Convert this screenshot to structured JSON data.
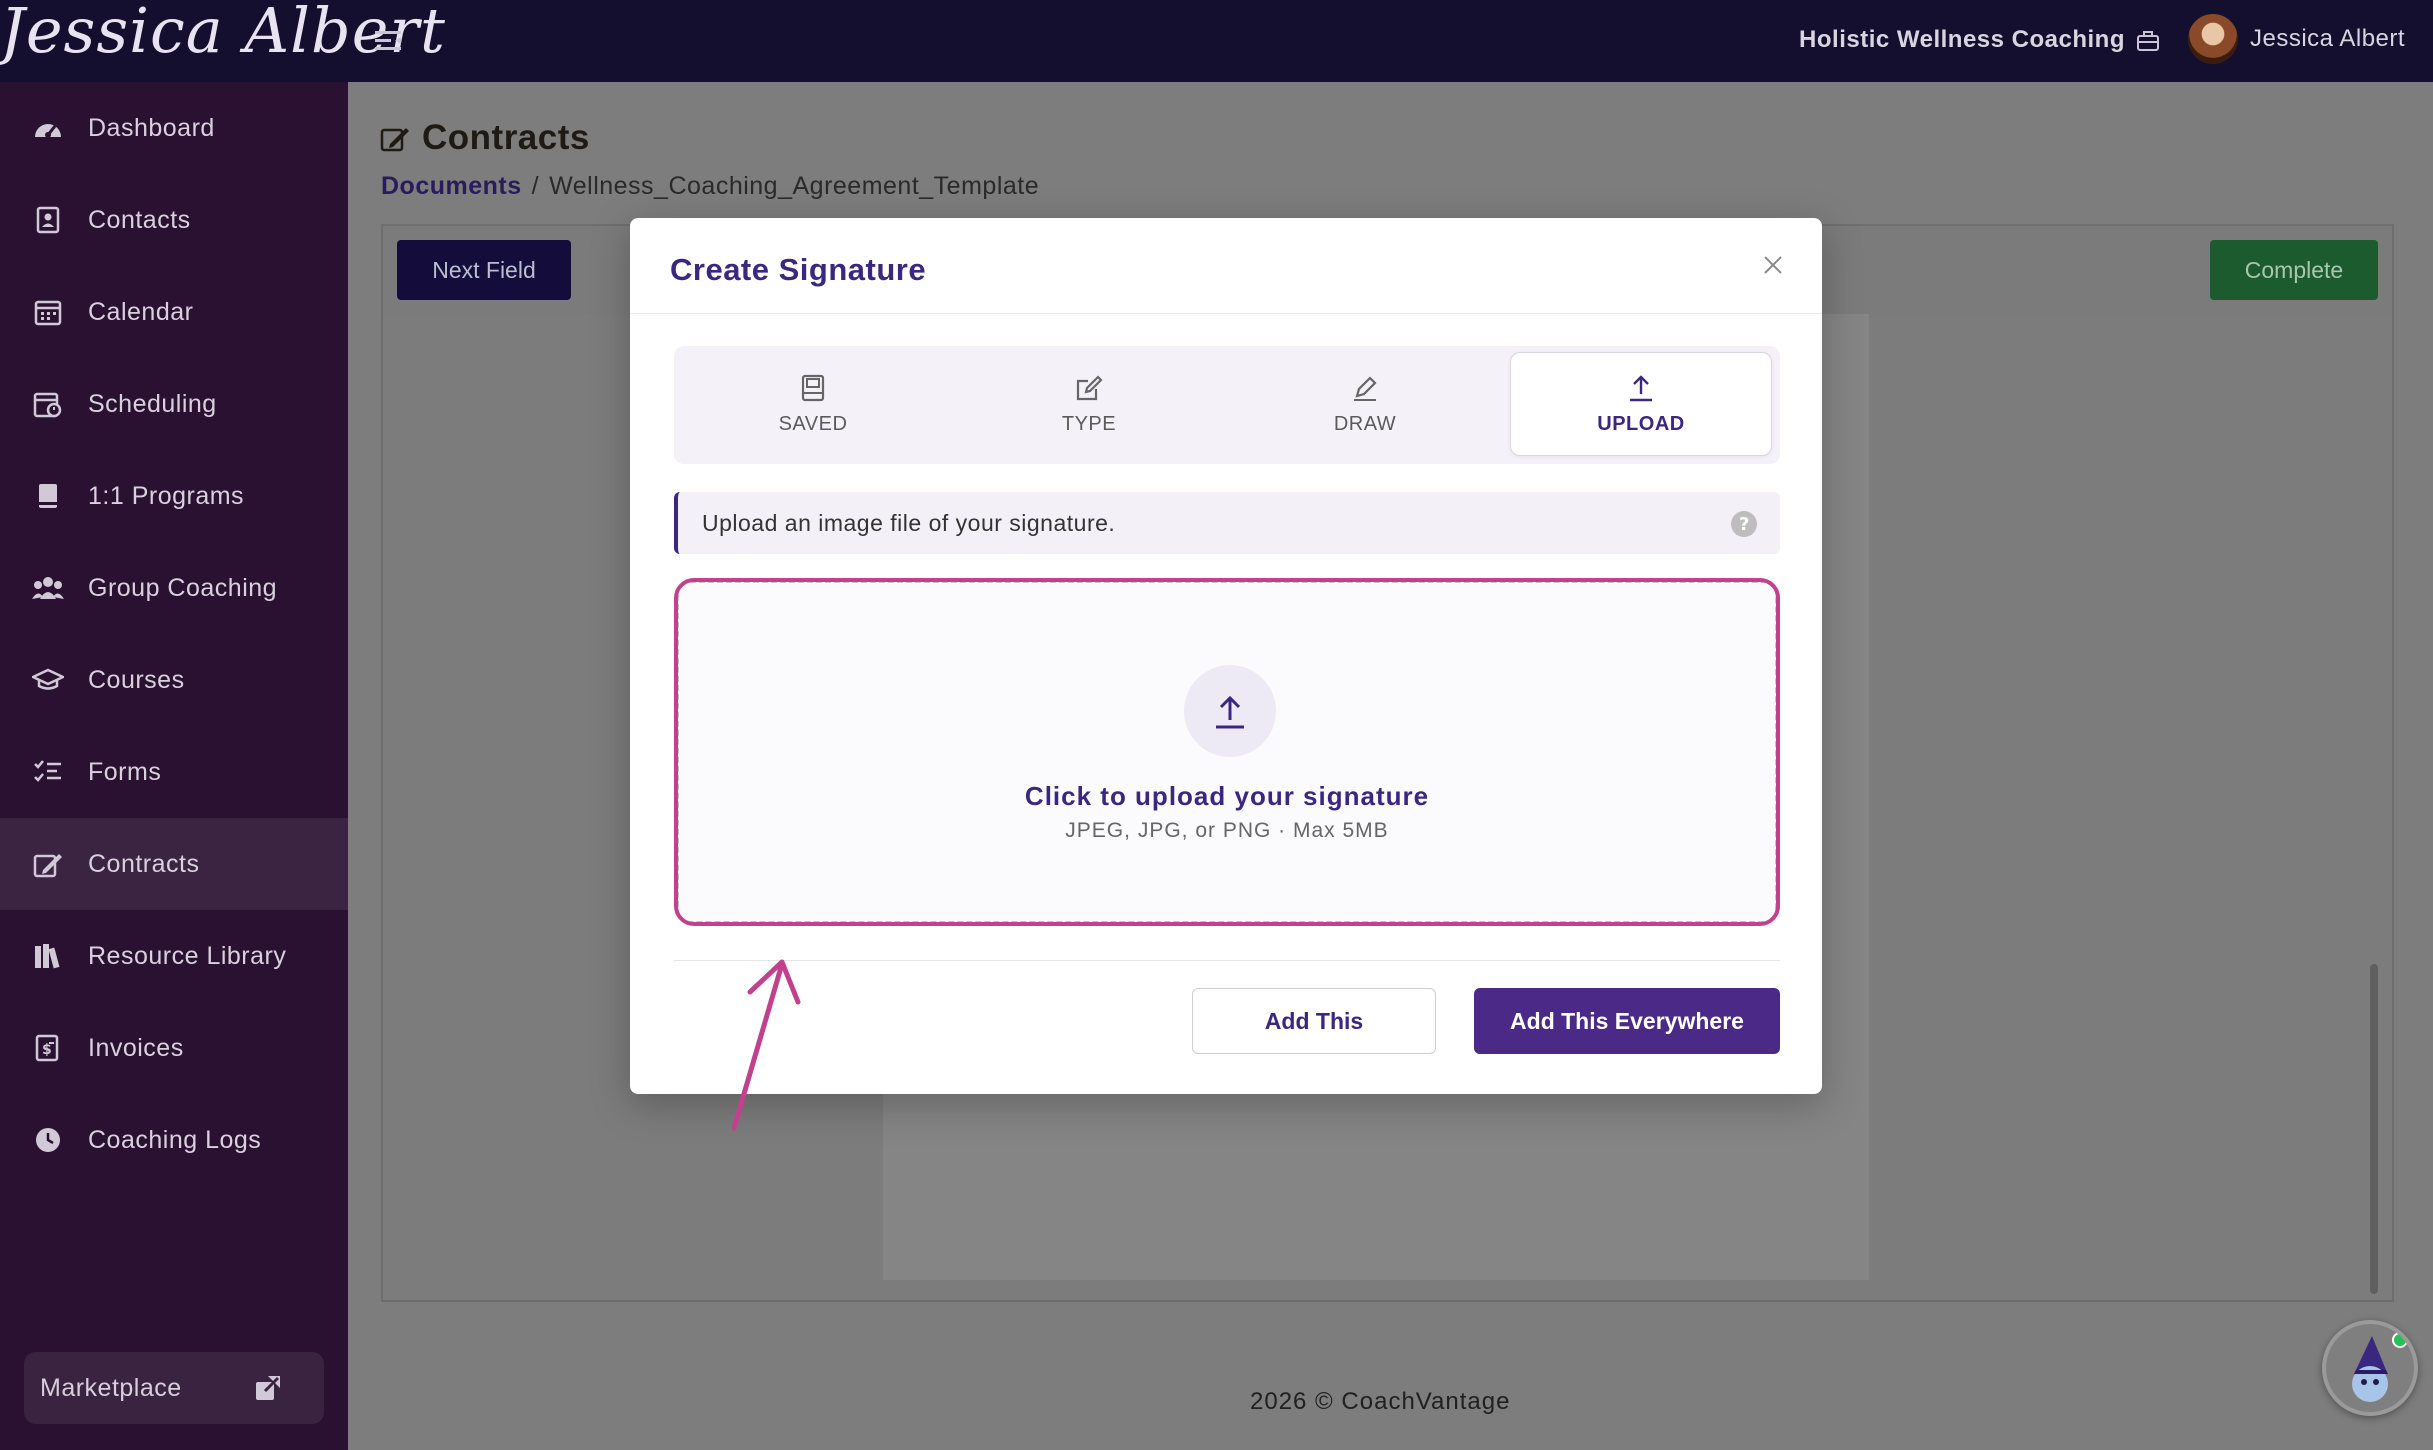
{
  "header": {
    "brand": "Jessica Albert",
    "organization": "Holistic Wellness Coaching",
    "user_name": "Jessica Albert"
  },
  "sidebar": {
    "items": [
      {
        "label": "Dashboard",
        "icon": "dashboard-icon"
      },
      {
        "label": "Contacts",
        "icon": "contacts-icon"
      },
      {
        "label": "Calendar",
        "icon": "calendar-icon"
      },
      {
        "label": "Scheduling",
        "icon": "scheduling-icon"
      },
      {
        "label": "1:1 Programs",
        "icon": "book-icon"
      },
      {
        "label": "Group Coaching",
        "icon": "group-icon"
      },
      {
        "label": "Courses",
        "icon": "graduation-cap-icon"
      },
      {
        "label": "Forms",
        "icon": "list-check-icon"
      },
      {
        "label": "Contracts",
        "icon": "signature-icon",
        "active": true
      },
      {
        "label": "Resource Library",
        "icon": "library-icon"
      },
      {
        "label": "Invoices",
        "icon": "invoice-icon"
      },
      {
        "label": "Coaching Logs",
        "icon": "clock-icon"
      }
    ],
    "marketplace": "Marketplace"
  },
  "main": {
    "title": "Contracts",
    "breadcrumb": {
      "parent": "Documents",
      "separator": "/",
      "current": "Wellness_Coaching_Agreement_Template"
    },
    "toolbar": {
      "next_field": "Next Field",
      "complete": "Complete"
    },
    "footer": "2026 © CoachVantage"
  },
  "modal": {
    "title": "Create Signature",
    "tabs": [
      {
        "label": "SAVED",
        "icon": "saved-icon"
      },
      {
        "label": "TYPE",
        "icon": "edit-icon"
      },
      {
        "label": "DRAW",
        "icon": "pen-icon"
      },
      {
        "label": "UPLOAD",
        "icon": "upload-icon",
        "active": true
      }
    ],
    "info": "Upload an image file of your signature.",
    "dropzone": {
      "title": "Click to upload your signature",
      "subtitle": "JPEG, JPG, or PNG · Max 5MB"
    },
    "buttons": {
      "add_this": "Add This",
      "add_everywhere": "Add This Everywhere"
    }
  },
  "colors": {
    "accent": "#3c2780",
    "sidebar": "#2a1131",
    "topbar": "#140f2e",
    "highlight": "#c2418d",
    "complete": "#1c5b2e"
  }
}
